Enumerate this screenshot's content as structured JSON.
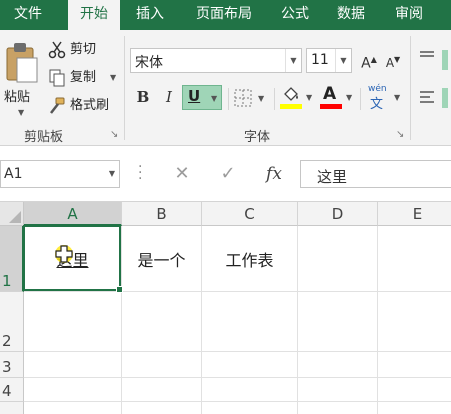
{
  "tabs": [
    {
      "label": "文件",
      "active": false
    },
    {
      "label": "开始",
      "active": true
    },
    {
      "label": "插入",
      "active": false
    },
    {
      "label": "页面布局",
      "active": false
    },
    {
      "label": "公式",
      "active": false
    },
    {
      "label": "数据",
      "active": false
    },
    {
      "label": "审阅",
      "active": false
    }
  ],
  "clipboard": {
    "paste_label": "粘贴",
    "cut_label": "剪切",
    "copy_label": "复制",
    "format_painter_label": "格式刷",
    "group_label": "剪贴板"
  },
  "font": {
    "font_name": "宋体",
    "font_size": "11",
    "bold_label": "B",
    "italic_label": "I",
    "underline_label": "U",
    "font_color_letter": "A",
    "phonetic_top": "wén",
    "phonetic_bottom": "文",
    "grow_label": "A",
    "shrink_label": "A",
    "group_label": "字体",
    "fill_color": "#ffff00",
    "font_color": "#ff0000"
  },
  "formula_bar": {
    "name_box": "A1",
    "fx_label": "fx",
    "content": "这里"
  },
  "grid": {
    "columns": [
      "A",
      "B",
      "C",
      "D",
      "E"
    ],
    "rows": [
      "1",
      "2",
      "3",
      "4"
    ],
    "cells": {
      "A1": "这里",
      "B1": "是一个",
      "C1": "工作表"
    }
  },
  "colors": {
    "accent": "#217346",
    "ribbon_bg": "#f3f3f3",
    "underline_active_bg": "#9fd5b7"
  }
}
